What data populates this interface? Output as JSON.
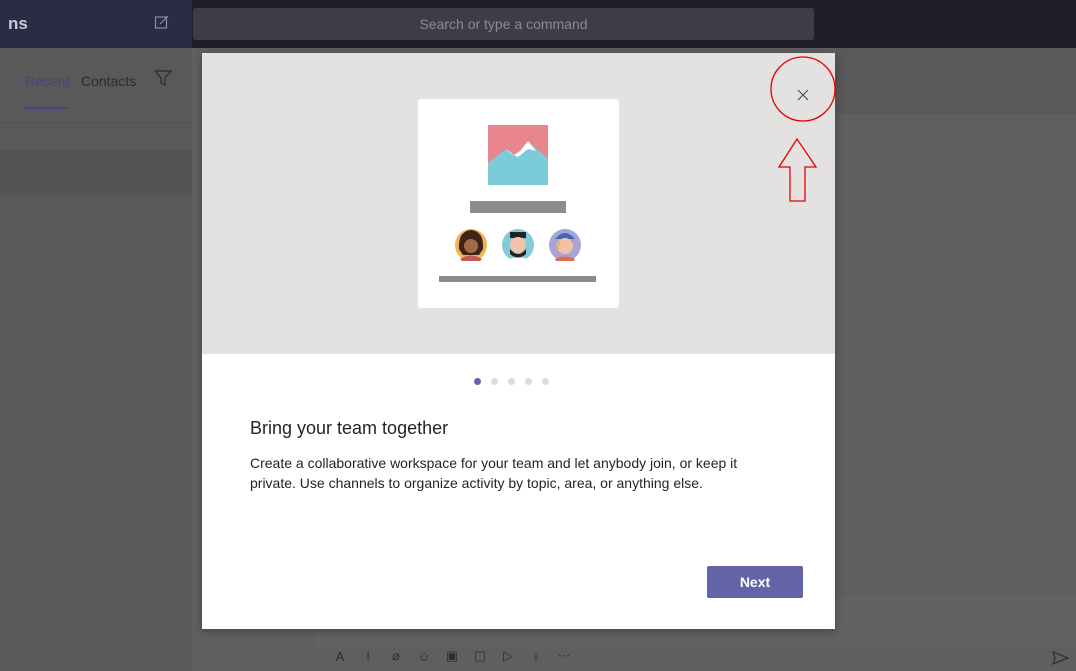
{
  "app": {
    "title": "ns"
  },
  "search": {
    "placeholder": "Search or type a command"
  },
  "sidebar": {
    "tabs": [
      {
        "label": "Recent"
      },
      {
        "label": "Contacts"
      }
    ]
  },
  "dialog": {
    "title": "Bring your team together",
    "description": "Create a collaborative workspace for your team and let anybody join, or keep it private. Use channels to organize activity by topic, area, or anything else.",
    "next_label": "Next",
    "page_indicator": {
      "total": 5,
      "current": 1
    }
  },
  "compose_toolbar": {
    "icons": [
      "format-icon",
      "important-icon",
      "attach-icon",
      "emoji-icon",
      "gif-icon",
      "sticker-icon",
      "meet-icon",
      "praise-icon",
      "more-icon",
      "send-icon"
    ]
  },
  "annotation": {
    "color": "#e60000",
    "target": "close-button"
  },
  "colors": {
    "accent": "#6264a7",
    "titlebar": "#1f1f2a",
    "hero_bg": "#e4e2e1"
  }
}
